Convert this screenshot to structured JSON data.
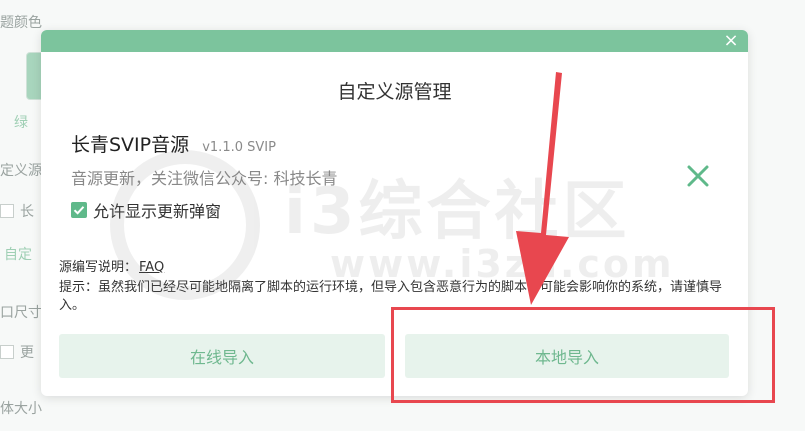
{
  "background": {
    "labels": {
      "theme_color": "题颜色",
      "green": "绿",
      "custom_source": "定义源",
      "long_source": "长",
      "custom": "自定",
      "size": "口尺寸",
      "update": "更",
      "font_size": "体大小"
    }
  },
  "modal": {
    "title": "自定义源管理",
    "close_glyph": "×",
    "source": {
      "name": "长青SVIP音源",
      "version": "v1.1.0  SVIP",
      "description": "音源更新，关注微信公众号: 科技长青",
      "allow_update_popup_label": "允许显示更新弹窗",
      "allow_update_popup_checked": true
    },
    "faq": {
      "prefix": "源编写说明：",
      "link": "FAQ"
    },
    "tip": "提示：虽然我们已经尽可能地隔离了脚本的运行环境，但导入包含恶意行为的脚本仍可能会影响你的系统，请谨慎导入。",
    "buttons": {
      "online_import": "在线导入",
      "local_import": "本地导入"
    }
  },
  "watermark": {
    "big": "i3综合社区",
    "small": "www.i3zh.com"
  },
  "colors": {
    "accent": "#7cc49d",
    "button_bg": "#e7f3ec",
    "button_text": "#6fb88f",
    "annotation_red": "#e8474f"
  },
  "icons": {
    "close": "close-icon",
    "remove": "remove-x-icon",
    "check": "check-icon"
  }
}
